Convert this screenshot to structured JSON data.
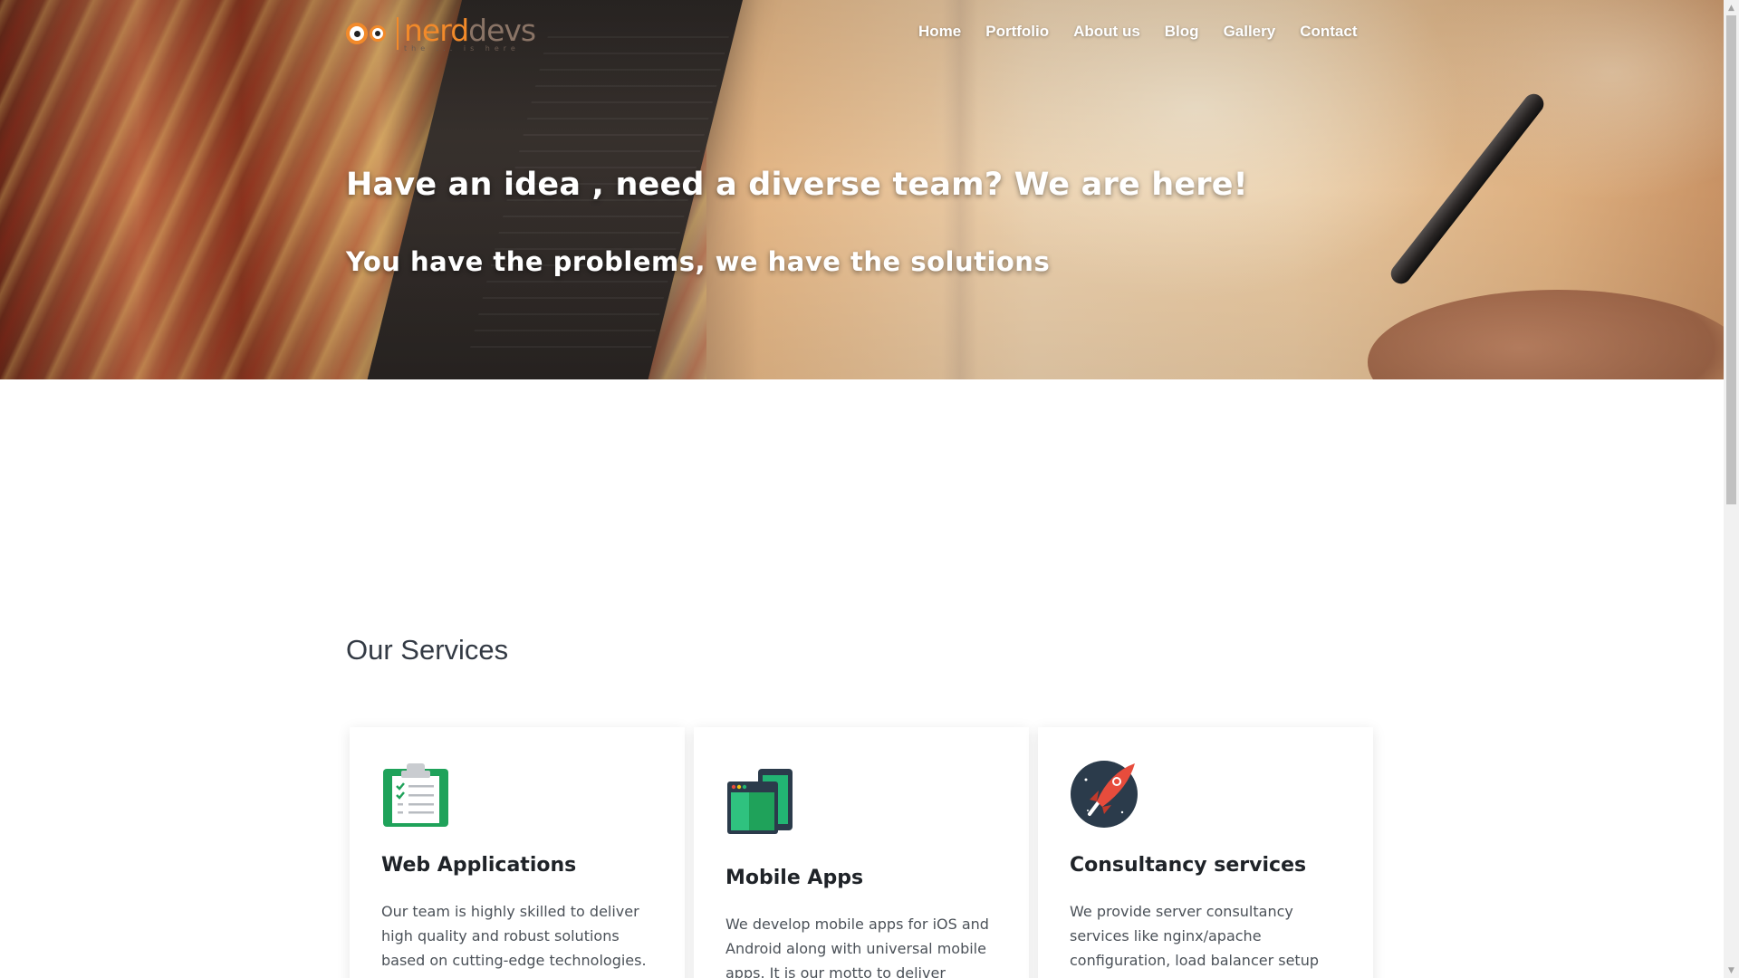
{
  "brand": {
    "name_part1": "nerd",
    "name_part2": "devs",
    "tagline": "the ... is here",
    "primary_color": "#f28a2a",
    "secondary_color": "#8a7466"
  },
  "nav": {
    "items": [
      "Home",
      "Portfolio",
      "About us",
      "Blog",
      "Gallery",
      "Contact"
    ]
  },
  "hero": {
    "title": "Have an idea , need a diverse team? We are here!",
    "subtitle": "You have the problems, we have the solutions"
  },
  "services": {
    "title": "Our Services",
    "cards": [
      {
        "icon": "clipboard-checklist-icon",
        "title": "Web Applications",
        "text": "Our team is highly skilled to deliver high quality and robust solutions based on cutting-edge technologies. We"
      },
      {
        "icon": "devices-icon",
        "title": "Mobile Apps",
        "text": "We develop mobile apps for iOS and Android along with universal mobile apps. It is our motto to deliver elegant"
      },
      {
        "icon": "rocket-icon",
        "title": "Consultancy services",
        "text": "We provide server consultancy services like nginx/apache configuration, load balancer setup and"
      }
    ]
  },
  "scrollbar": {
    "up_icon": "▲",
    "down_icon": "▼"
  }
}
